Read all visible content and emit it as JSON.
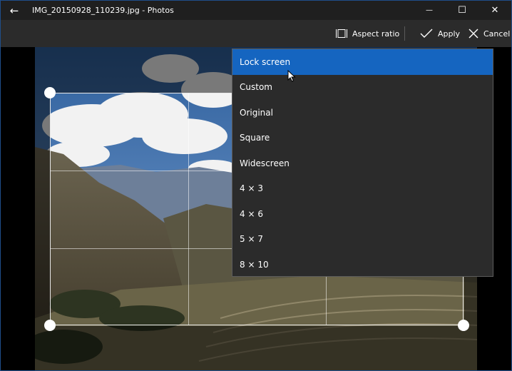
{
  "window": {
    "title": "IMG_20150928_110239.jpg - Photos",
    "back_icon": "←",
    "minimize_icon": "—",
    "maximize_icon": "☐",
    "close_icon": "✕"
  },
  "toolbar": {
    "aspect_ratio_label": "Aspect ratio",
    "apply_label": "Apply",
    "cancel_label": "Cancel"
  },
  "aspect_menu": {
    "selected": "Lock screen",
    "items": [
      "Lock screen",
      "Custom",
      "Original",
      "Square",
      "Widescreen",
      "4 × 3",
      "4 × 6",
      "5 × 7",
      "8 × 10"
    ]
  },
  "colors": {
    "accent": "#1565c0",
    "titlebar": "#1f1f1f",
    "toolbar": "#2b2b2b"
  }
}
